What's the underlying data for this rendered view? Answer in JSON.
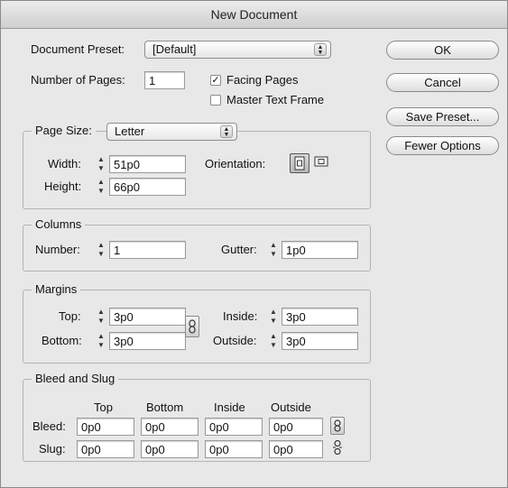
{
  "dialog": {
    "title": "New Document"
  },
  "preset": {
    "label": "Document Preset:",
    "value": "[Default]"
  },
  "pages": {
    "label": "Number of Pages:",
    "value": "1",
    "facing_label": "Facing Pages",
    "facing_checked": true,
    "master_label": "Master Text Frame",
    "master_checked": false
  },
  "buttons": {
    "ok": "OK",
    "cancel": "Cancel",
    "save_preset": "Save Preset...",
    "fewer_options": "Fewer Options"
  },
  "page_size": {
    "label": "Page Size:",
    "value": "Letter",
    "width_label": "Width:",
    "width": "51p0",
    "height_label": "Height:",
    "height": "66p0",
    "orientation_label": "Orientation:",
    "orientation_selected": "portrait",
    "portrait_icon": "portrait-orientation-icon",
    "landscape_icon": "landscape-orientation-icon"
  },
  "columns": {
    "title": "Columns",
    "number_label": "Number:",
    "number": "1",
    "gutter_label": "Gutter:",
    "gutter": "1p0"
  },
  "margins": {
    "title": "Margins",
    "top_label": "Top:",
    "top": "3p0",
    "bottom_label": "Bottom:",
    "bottom": "3p0",
    "inside_label": "Inside:",
    "inside": "3p0",
    "outside_label": "Outside:",
    "outside": "3p0",
    "link_icon": "chain-link-icon"
  },
  "bleed_slug": {
    "title": "Bleed and Slug",
    "headers": [
      "Top",
      "Bottom",
      "Inside",
      "Outside"
    ],
    "bleed_label": "Bleed:",
    "bleed": [
      "0p0",
      "0p0",
      "0p0",
      "0p0"
    ],
    "slug_label": "Slug:",
    "slug": [
      "0p0",
      "0p0",
      "0p0",
      "0p0"
    ],
    "bleed_link_icon": "chain-link-icon",
    "slug_link_icon": "broken-chain-icon"
  }
}
